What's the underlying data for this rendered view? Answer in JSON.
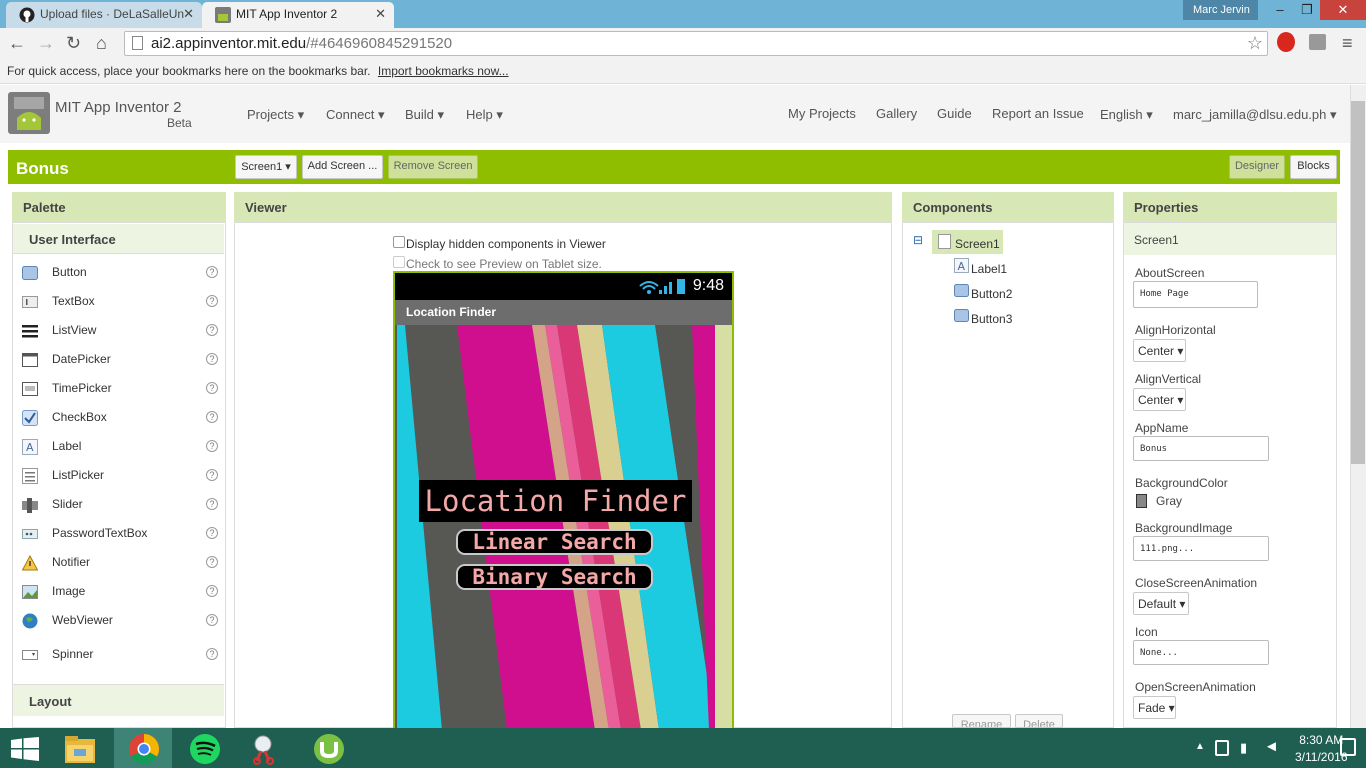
{
  "browser": {
    "tabs": [
      {
        "title": "Upload files · DeLaSalleUn",
        "close": "✕"
      },
      {
        "title": "MIT App Inventor 2",
        "close": "✕"
      }
    ],
    "user": "Marc Jervin",
    "window_controls": [
      "–",
      "❐",
      "✕"
    ],
    "url_host": "ai2.appinventor.mit.edu",
    "url_rest": "/#4646960845291520",
    "bookmarks_prompt": "For quick access, place your bookmarks here on the bookmarks bar.",
    "import_link": "Import bookmarks now..."
  },
  "app_header": {
    "title": "MIT App Inventor 2",
    "subtitle": "Beta",
    "menus": [
      "Projects ▾",
      "Connect ▾",
      "Build ▾",
      "Help ▾"
    ],
    "right_links": [
      "My Projects",
      "Gallery",
      "Guide",
      "Report an Issue",
      "English ▾",
      "marc_jamilla@dlsu.edu.ph ▾"
    ]
  },
  "toolbar": {
    "project_name": "Bonus",
    "screen_select": "Screen1 ▾",
    "add_screen": "Add Screen ...",
    "remove_screen": "Remove Screen",
    "designer": "Designer",
    "blocks": "Blocks"
  },
  "palette": {
    "title": "Palette",
    "category": "User Interface",
    "items": [
      {
        "label": "Button",
        "icon": "button-icon"
      },
      {
        "label": "TextBox",
        "icon": "textbox-icon"
      },
      {
        "label": "ListView",
        "icon": "listview-icon"
      },
      {
        "label": "DatePicker",
        "icon": "datepicker-icon"
      },
      {
        "label": "TimePicker",
        "icon": "timepicker-icon"
      },
      {
        "label": "CheckBox",
        "icon": "checkbox-icon"
      },
      {
        "label": "Label",
        "icon": "label-icon"
      },
      {
        "label": "ListPicker",
        "icon": "listpicker-icon"
      },
      {
        "label": "Slider",
        "icon": "slider-icon"
      },
      {
        "label": "PasswordTextBox",
        "icon": "password-icon"
      },
      {
        "label": "Notifier",
        "icon": "notifier-icon"
      },
      {
        "label": "Image",
        "icon": "image-icon"
      },
      {
        "label": "WebViewer",
        "icon": "webviewer-icon"
      },
      {
        "label": "Spinner",
        "icon": "spinner-icon"
      }
    ],
    "help_glyph": "?",
    "layout_category": "Layout"
  },
  "viewer": {
    "title": "Viewer",
    "show_hidden": "Display hidden components in Viewer",
    "tablet_preview": "Check to see Preview on Tablet size.",
    "phone": {
      "clock": "9:48",
      "title": "Location Finder",
      "label_text": "Location Finder",
      "button1": "Linear Search",
      "button2": "Binary Search"
    },
    "stripe_colors": [
      "#1ccbdf",
      "#575754",
      "#cf0f8e",
      "#d6c98d",
      "#ea5e99",
      "#d3a487",
      "#d8cf91",
      "#1ccbdf",
      "#575754"
    ]
  },
  "components": {
    "title": "Components",
    "collapse_glyph": "⊟",
    "tree": [
      {
        "label": "Screen1",
        "icon": "screen-icon"
      },
      {
        "label": "Label1",
        "icon": "label-icon"
      },
      {
        "label": "Button2",
        "icon": "button-icon"
      },
      {
        "label": "Button3",
        "icon": "button-icon"
      }
    ],
    "rename": "Rename",
    "delete": "Delete"
  },
  "properties": {
    "title": "Properties",
    "screen": "Screen1",
    "about_label": "AboutScreen",
    "about_value": "Home Page",
    "align_h_label": "AlignHorizontal",
    "align_h_value": "Center ▾",
    "align_v_label": "AlignVertical",
    "align_v_value": "Center ▾",
    "appname_label": "AppName",
    "appname_value": "Bonus",
    "bgcolor_label": "BackgroundColor",
    "bgcolor_value": "Gray",
    "bgimage_label": "BackgroundImage",
    "bgimage_value": "111.png...",
    "close_anim_label": "CloseScreenAnimation",
    "close_anim_value": "Default ▾",
    "icon_label": "Icon",
    "icon_value": "None...",
    "open_anim_label": "OpenScreenAnimation",
    "open_anim_value": "Fade ▾"
  },
  "taskbar": {
    "time": "8:30 AM",
    "date": "3/11/2016",
    "apps": [
      "windows-start-icon",
      "file-explorer-icon",
      "chrome-icon",
      "spotify-icon",
      "snipping-tool-icon",
      "utorrent-icon"
    ]
  },
  "colors": {
    "accent_green": "#8fbe00",
    "panel_header": "#d7e7b6",
    "taskbar": "#1e5f52"
  }
}
